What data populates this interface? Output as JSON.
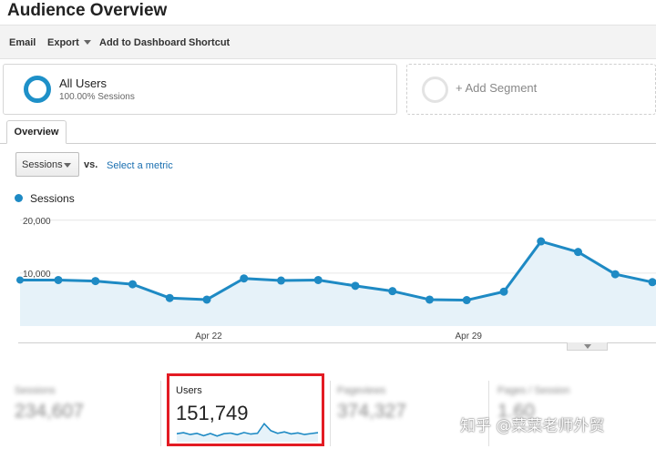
{
  "header": {
    "title": "Audience Overview"
  },
  "toolbar": {
    "email": "Email",
    "export": "Export",
    "add_to_dashboard": "Add to Dashboard",
    "shortcut": "Shortcut"
  },
  "segments": {
    "active": {
      "name": "All Users",
      "detail": "100.00% Sessions"
    },
    "add_label": "+ Add Segment"
  },
  "tabs": [
    {
      "label": "Overview",
      "active": true
    }
  ],
  "metric_controls": {
    "selected": "Sessions",
    "vs_label": "vs.",
    "select_metric": "Select a metric"
  },
  "colors": {
    "accent": "#1e8ac4",
    "fill": "#e6f2f9",
    "highlight": "#e31b23"
  },
  "chart_data": {
    "type": "area",
    "series": [
      {
        "name": "Sessions",
        "values": [
          8700,
          8500,
          7900,
          5300,
          5000,
          9000,
          8600,
          8700,
          7600,
          6600,
          5000,
          4900,
          6500,
          16000,
          14000,
          9800,
          8300
        ]
      }
    ],
    "ytick_labels": [
      "20,000",
      "10,000"
    ],
    "yticks": [
      20000,
      10000
    ],
    "ylim": [
      0,
      21000
    ],
    "xtick_labels": [
      "Apr 22",
      "Apr 29"
    ],
    "xtick_indices": [
      4,
      11
    ]
  },
  "scorecards": [
    {
      "label": "Sessions",
      "value": "234,607",
      "blurred": true
    },
    {
      "label": "Users",
      "value": "151,749",
      "blurred": false,
      "highlighted": true,
      "spark": [
        4,
        4.5,
        3.6,
        4.2,
        3,
        4.1,
        2.8,
        4,
        4.3,
        3.5,
        4.6,
        3.8,
        4.2,
        9,
        5.5,
        4.2,
        4.9,
        3.9,
        4.4,
        3.6,
        4.1,
        4.5
      ]
    },
    {
      "label": "Pageviews",
      "value": "374,327",
      "blurred": true
    },
    {
      "label": "Pages / Session",
      "value": "1.60",
      "blurred": true
    }
  ],
  "watermark": "知乎 @菜菜老师外贸"
}
